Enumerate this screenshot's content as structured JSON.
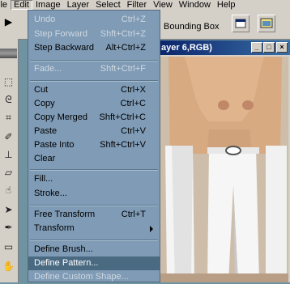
{
  "menubar": {
    "items": [
      "ile",
      "Edit",
      "Image",
      "Layer",
      "Select",
      "Filter",
      "View",
      "Window",
      "Help"
    ],
    "active_index": 1
  },
  "options_bar": {
    "bounding_box_label": "Bounding Box"
  },
  "document_window": {
    "title": "ayer 6,RGB)",
    "buttons": [
      "_",
      "□",
      "×"
    ]
  },
  "edit_menu": {
    "items": [
      {
        "label": "Undo",
        "shortcut": "Ctrl+Z",
        "enabled": false
      },
      {
        "label": "Step Forward",
        "shortcut": "Shft+Ctrl+Z",
        "enabled": false
      },
      {
        "label": "Step Backward",
        "shortcut": "Alt+Ctrl+Z",
        "enabled": true
      },
      {
        "separator": true
      },
      {
        "label": "Fade...",
        "shortcut": "Shft+Ctrl+F",
        "enabled": false
      },
      {
        "separator": true
      },
      {
        "label": "Cut",
        "shortcut": "Ctrl+X",
        "enabled": true
      },
      {
        "label": "Copy",
        "shortcut": "Ctrl+C",
        "enabled": true
      },
      {
        "label": "Copy Merged",
        "shortcut": "Shft+Ctrl+C",
        "enabled": true
      },
      {
        "label": "Paste",
        "shortcut": "Ctrl+V",
        "enabled": true
      },
      {
        "label": "Paste Into",
        "shortcut": "Shft+Ctrl+V",
        "enabled": true
      },
      {
        "label": "Clear",
        "shortcut": "",
        "enabled": true
      },
      {
        "separator": true
      },
      {
        "label": "Fill...",
        "shortcut": "",
        "enabled": true
      },
      {
        "label": "Stroke...",
        "shortcut": "",
        "enabled": true
      },
      {
        "separator": true
      },
      {
        "label": "Free Transform",
        "shortcut": "Ctrl+T",
        "enabled": true
      },
      {
        "label": "Transform",
        "shortcut": "",
        "enabled": true,
        "submenu": true
      },
      {
        "separator": true
      },
      {
        "label": "Define Brush...",
        "shortcut": "",
        "enabled": true
      },
      {
        "label": "Define Pattern...",
        "shortcut": "",
        "enabled": true,
        "highlighted": true
      },
      {
        "label": "Define Custom Shape...",
        "shortcut": "",
        "enabled": false
      }
    ]
  },
  "colors": {
    "menu_bg": "#7f9bb6",
    "menu_highlight": "#4a6a82",
    "chrome": "#d4d0c8",
    "titlebar": "#0a246a"
  },
  "tool_icons": [
    "arrow-icon",
    "marquee-icon",
    "lasso-icon",
    "crop-icon",
    "brush-icon",
    "stamp-icon",
    "eraser-icon",
    "smudge-icon",
    "path-select-icon",
    "pen-icon",
    "notes-icon",
    "hand-icon"
  ]
}
